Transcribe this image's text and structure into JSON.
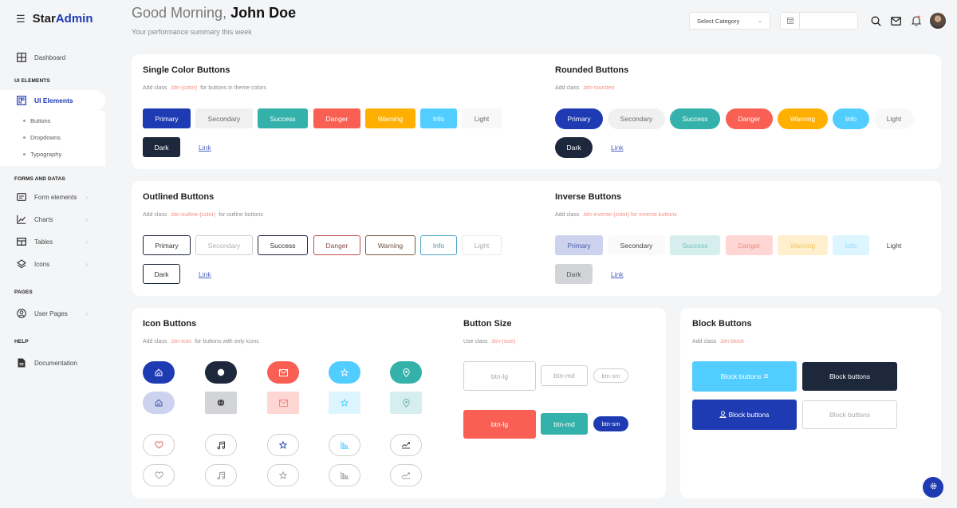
{
  "app": {
    "brand_part1": "Star",
    "brand_part2": "Admin"
  },
  "header": {
    "greeting_prefix": "Good Morning,",
    "user_name": "John Doe",
    "subtitle": "Your performance summary this week",
    "category_select": "Select Category",
    "date_value": ""
  },
  "sidebar": {
    "dashboard": "Dashboard",
    "section_ui": "UI ELEMENTS",
    "ui_elements": "UI Elements",
    "sub_items": [
      "Buttons",
      "Dropdowns",
      "Typography"
    ],
    "section_forms": "FORMS AND DATAS",
    "forms_items": [
      "Form elements",
      "Charts",
      "Tables",
      "Icons"
    ],
    "section_pages": "PAGES",
    "user_pages": "User Pages",
    "section_help": "HELP",
    "documentation": "Documentation"
  },
  "colors": {
    "primary": "#1f3bb3",
    "secondary": "#f0f0f0",
    "success": "#34b1aa",
    "danger": "#f95f53",
    "warning": "#ffaf00",
    "info": "#52cdff",
    "light": "#f8f8f8",
    "dark": "#1e283d"
  },
  "single_color": {
    "title": "Single Color Buttons",
    "desc_prefix": "Add class",
    "desc_code": ".btn-{color}",
    "desc_suffix": "for buttons in theme colors",
    "buttons": [
      "Primary",
      "Secondary",
      "Success",
      "Danger",
      "Warning",
      "Info",
      "Light",
      "Dark"
    ],
    "link": "Link"
  },
  "rounded": {
    "title": "Rounded Buttons",
    "desc_prefix": "Add class",
    "desc_code": ".btn-rounded",
    "buttons": [
      "Primary",
      "Secondary",
      "Success",
      "Danger",
      "Warning",
      "Info",
      "Light",
      "Dark"
    ],
    "link": "Link"
  },
  "outlined": {
    "title": "Outlined Buttons",
    "desc_prefix": "Add class",
    "desc_code": ".btn-outline-{color}",
    "desc_suffix": "for outline buttons",
    "buttons": [
      "Primary",
      "Secondary",
      "Success",
      "Danger",
      "Warning",
      "Info",
      "Light",
      "Dark"
    ],
    "link": "Link"
  },
  "inverse": {
    "title": "Inverse Buttons",
    "desc_prefix": "Add class",
    "desc_code": ".btn-inverse-{color} for inverse buttons",
    "buttons": [
      "Primary",
      "Secondary",
      "Success",
      "Danger",
      "Warning",
      "Info",
      "Light",
      "Dark"
    ],
    "link": "Link"
  },
  "icon_buttons": {
    "title": "Icon Buttons",
    "desc_prefix": "Add class",
    "desc_code": ".btn-icon",
    "desc_suffix": "for buttons with only icons",
    "row1_icons": [
      "home-icon",
      "globe-icon",
      "mail-icon",
      "star-icon",
      "map-pin-icon"
    ],
    "row3_icons": [
      "heart-icon",
      "music-icon",
      "star-icon",
      "bar-chart-icon",
      "trend-icon"
    ]
  },
  "button_size": {
    "title": "Button Size",
    "desc_prefix": "Use class",
    "desc_code": ".btn-{size}",
    "labels": [
      "btn-lg",
      "btn-md",
      "btn-sm"
    ]
  },
  "block_buttons": {
    "title": "Block Buttons",
    "desc_prefix": "Add class",
    "desc_code": ".btn-block",
    "labels": [
      "Block buttons",
      "Block buttons",
      "Block buttons",
      "Block buttons"
    ]
  }
}
